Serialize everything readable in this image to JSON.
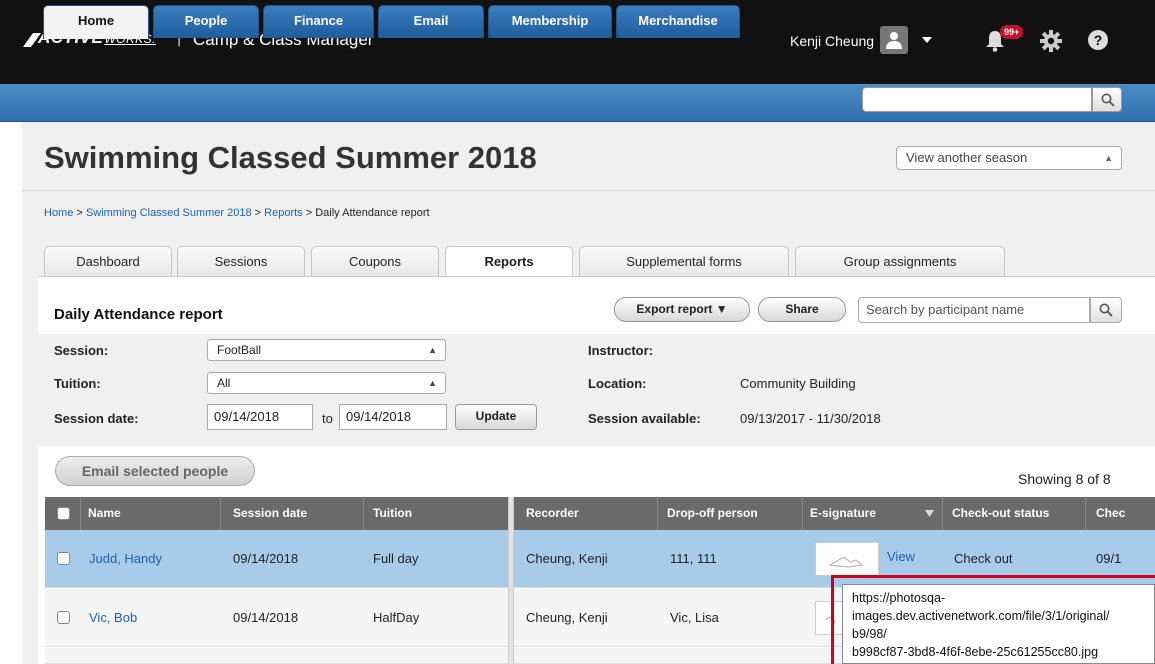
{
  "app": {
    "logo_main": "ACTIVE",
    "logo_sub": "WORKS.",
    "separator": "|",
    "title": "Camp & Class Manager",
    "user_name": "Kenji Cheung",
    "notification_badge": "99+"
  },
  "nav": {
    "tabs": [
      "Home",
      "People",
      "Finance",
      "Email",
      "Membership",
      "Merchandise"
    ],
    "active": "Home",
    "search_value": ""
  },
  "page": {
    "title": "Swimming Classed Summer 2018",
    "season_select": "View another season"
  },
  "breadcrumb": [
    "Home",
    "Swimming Classed Summer 2018",
    "Reports",
    "Daily Attendance report"
  ],
  "breadcrumb_sep": ">",
  "subtabs": [
    "Dashboard",
    "Sessions",
    "Coupons",
    "Reports",
    "Supplemental forms",
    "Group assignments"
  ],
  "report": {
    "title": "Daily Attendance report",
    "export_label": "Export report ▼",
    "share_label": "Share",
    "search_placeholder": "Search by participant name"
  },
  "filters": {
    "session_label": "Session:",
    "session_value": "FootBall",
    "tuition_label": "Tuition:",
    "tuition_value": "All",
    "date_label": "Session date:",
    "date_from": "09/14/2018",
    "date_to_label": "to",
    "date_to": "09/14/2018",
    "update_label": "Update",
    "instructor_label": "Instructor:",
    "instructor_value": "",
    "location_label": "Location:",
    "location_value": "Community Building",
    "available_label": "Session available:",
    "available_value": "09/13/2017 - 11/30/2018"
  },
  "actions": {
    "email_label": "Email selected people",
    "showing": "Showing 8 of 8"
  },
  "table": {
    "columns": [
      "Name",
      "Session date",
      "Tuition",
      "Recorder",
      "Drop-off person",
      "E-signature",
      "Check-out status",
      "Chec"
    ],
    "rows": [
      {
        "name": "Judd, Handy",
        "date": "09/14/2018",
        "tuition": "Full day",
        "recorder": "Cheung, Kenji",
        "dropoff": "111, 111",
        "sig_link": "View",
        "status": "Check out",
        "checkout": "09/1"
      },
      {
        "name": "Vic, Bob",
        "date": "09/14/2018",
        "tuition": "HalfDay",
        "recorder": "Cheung, Kenji",
        "dropoff": "Vic, Lisa",
        "sig_link": "",
        "status": "",
        "checkout": ""
      }
    ]
  },
  "tooltip": {
    "lines": [
      "https://photosqa-",
      "images.dev.activenetwork.com/file/3/1/original/",
      "b9/98/",
      "b998cf87-3bd8-4f6f-8ebe-25c61255cc80.jpg"
    ]
  },
  "colors": {
    "topbar": "#111111",
    "nav_blue": "#2d6eab",
    "link": "#1a63b0",
    "selected_row": "#a9cbea",
    "table_header": "#6a6a6a",
    "badge": "#c8102e",
    "highlight": "#d0021b"
  }
}
